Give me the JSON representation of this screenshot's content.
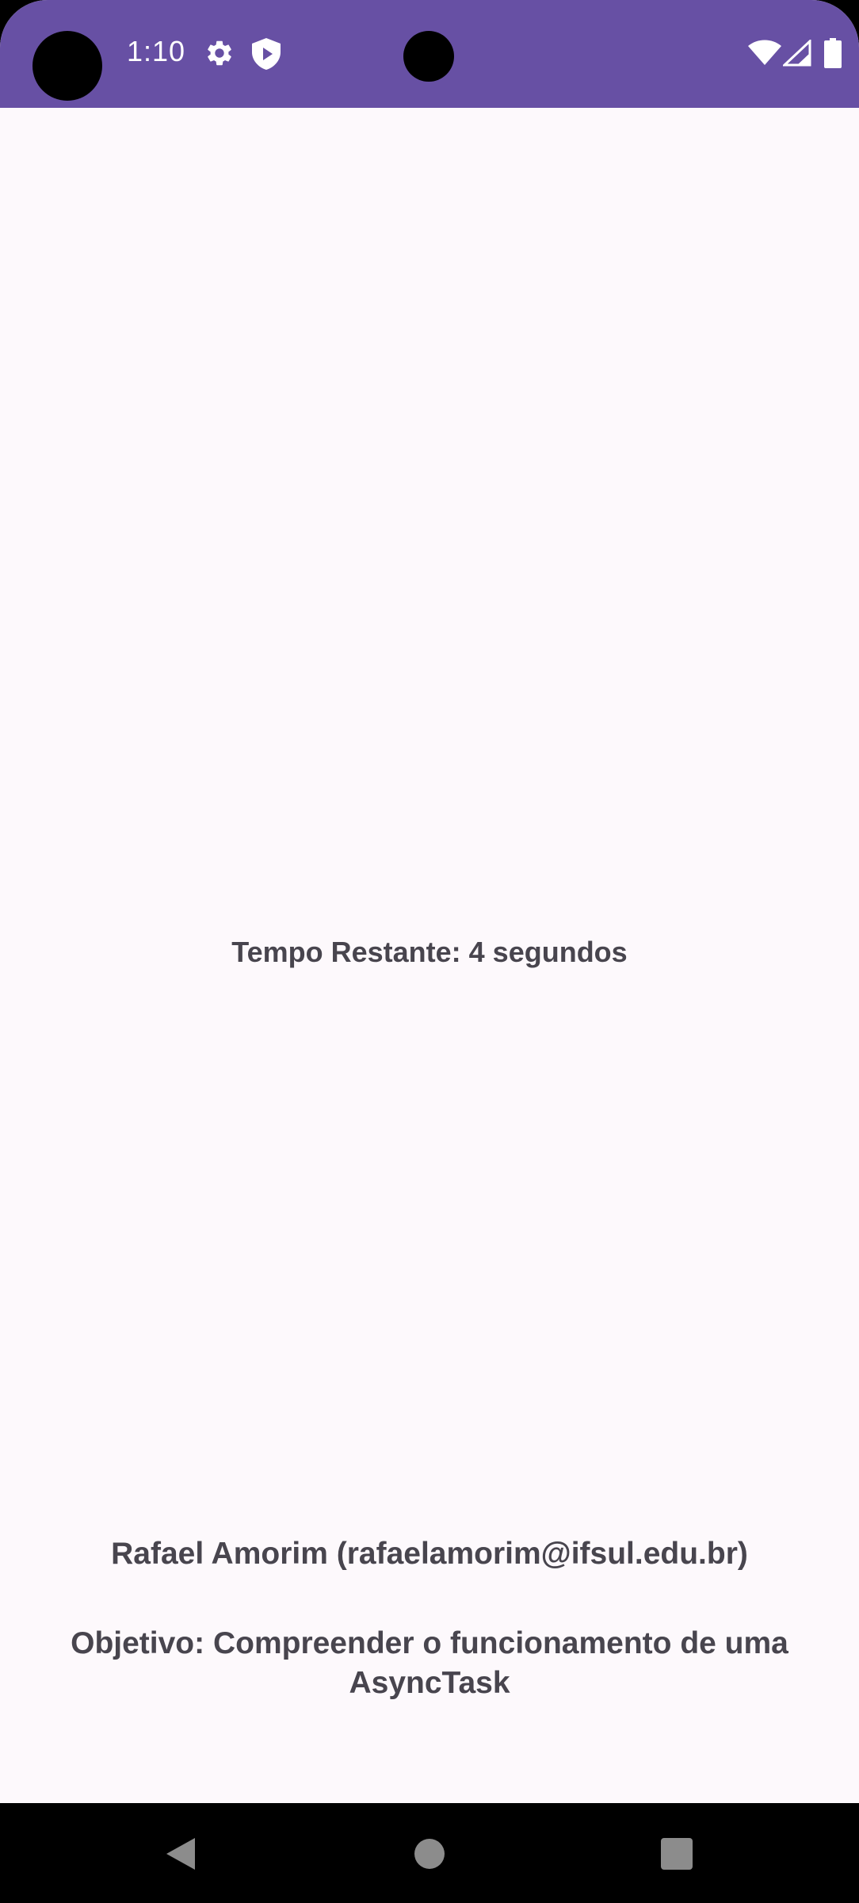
{
  "status_bar": {
    "time": "1:10",
    "color": "#6750a4",
    "icons": [
      "settings-icon",
      "shield-icon",
      "wifi-icon",
      "signal-icon",
      "battery-icon"
    ]
  },
  "main": {
    "timer_text": "Tempo Restante: 4 segundos",
    "author_text": "Rafael Amorim (rafaelamorim@ifsul.edu.br)",
    "objective_text": "Objetivo: Compreender o funcionamento de uma AsyncTask"
  },
  "nav_bar": {
    "buttons": [
      "back",
      "home",
      "recents"
    ]
  },
  "colors": {
    "status_bar": "#6750a4",
    "background": "#fdf9fc",
    "text": "#48454e",
    "nav_icons": "#8c8c8c"
  }
}
